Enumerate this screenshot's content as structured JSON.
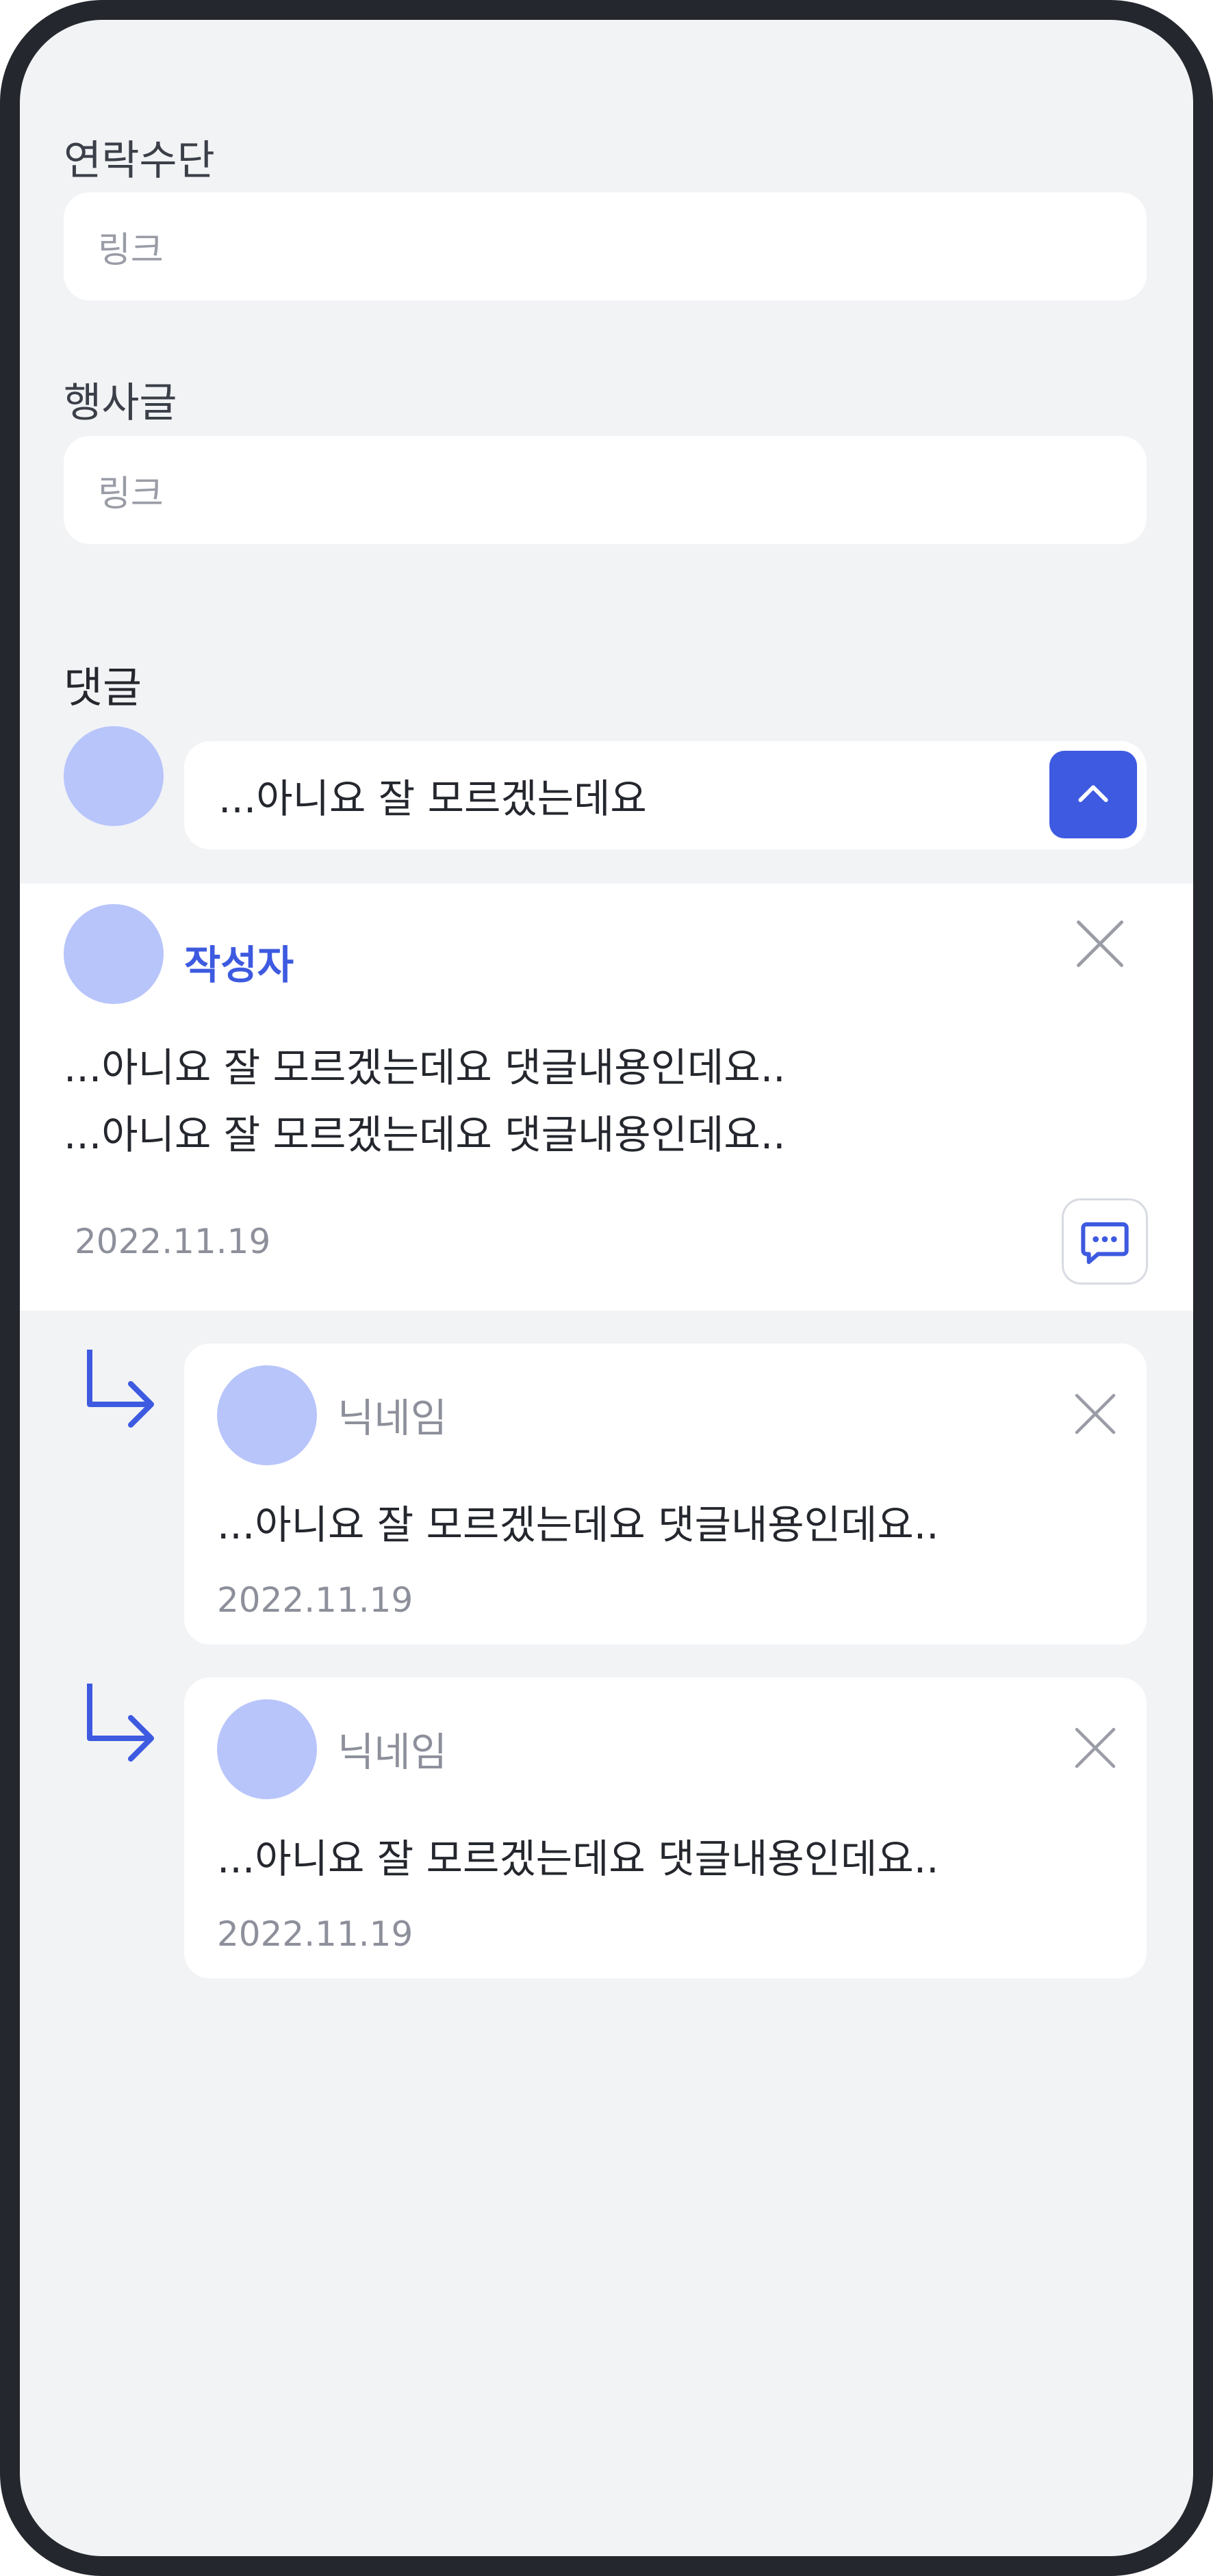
{
  "form": {
    "contact": {
      "label": "연락수단",
      "placeholder": "링크"
    },
    "event_post": {
      "label": "행사글",
      "placeholder": "링크"
    }
  },
  "comments": {
    "title": "댓글",
    "input_value": "...아니요 잘 모르겠는데요",
    "main": {
      "author": "작성자",
      "lines": [
        "...아니요 잘 모르겠는데요 댓글내용인데요..",
        "...아니요 잘 모르겠는데요 댓글내용인데요.."
      ],
      "date": "2022.11.19"
    },
    "replies": [
      {
        "nickname": "닉네임",
        "text": "...아니요 잘 모르겠는데요 댓글내용인데요..",
        "date": "2022.11.19"
      },
      {
        "nickname": "닉네임",
        "text": "...아니요 잘 모르겠는데요 댓글내용인데요..",
        "date": "2022.11.19"
      }
    ]
  },
  "colors": {
    "accent": "#3d5ae0",
    "avatar": "#b8c5fb",
    "background": "#f2f3f5",
    "frame": "#25272e"
  },
  "icons": [
    "chevron-up-icon",
    "close-icon",
    "chat-bubble-icon",
    "reply-arrow-icon"
  ]
}
